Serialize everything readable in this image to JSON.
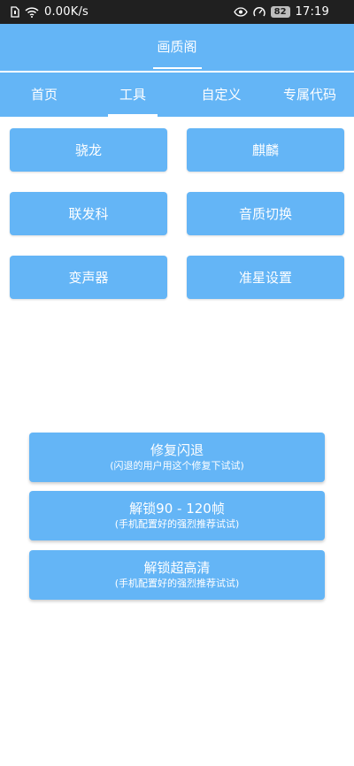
{
  "status_bar": {
    "speed": "0.00K/s",
    "battery": "82",
    "time": "17:19",
    "icons": [
      "sim-card-icon",
      "wifi-icon",
      "eye-icon",
      "speedometer-icon"
    ]
  },
  "header": {
    "title": "画质阁"
  },
  "tabs": [
    {
      "label": "首页"
    },
    {
      "label": "工具"
    },
    {
      "label": "自定义"
    },
    {
      "label": "专属代码"
    }
  ],
  "selected_tab": "工具",
  "grid_buttons": [
    {
      "label": "骁龙"
    },
    {
      "label": "麒麟"
    },
    {
      "label": "联发科"
    },
    {
      "label": "音质切换"
    },
    {
      "label": "变声器"
    },
    {
      "label": "准星设置"
    }
  ],
  "action_buttons": [
    {
      "label": "修复闪退",
      "sub": "(闪退的用户用这个修复下试试)"
    },
    {
      "label": "解锁90 - 120帧",
      "sub": "(手机配置好的强烈推荐试试)"
    },
    {
      "label": "解锁超高清",
      "sub": "(手机配置好的强烈推荐试试)"
    }
  ],
  "colors": {
    "accent": "#64b5f6",
    "status_bar": "#202020",
    "text_on_accent": "#ffffff"
  }
}
